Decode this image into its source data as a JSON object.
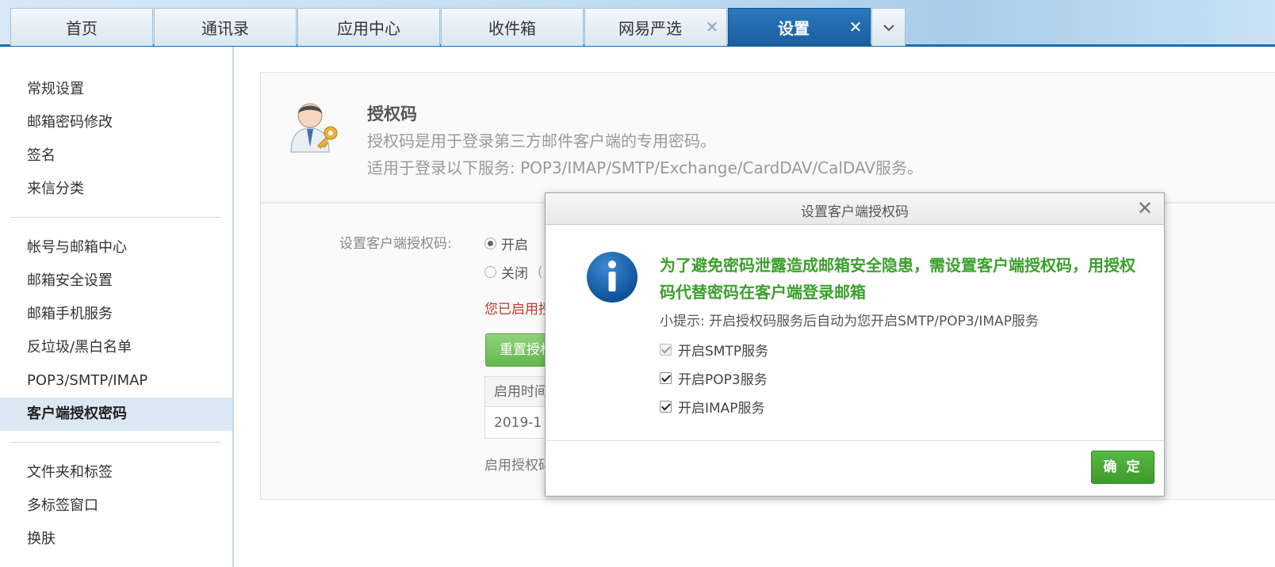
{
  "tabs": [
    {
      "label": "首页"
    },
    {
      "label": "通讯录"
    },
    {
      "label": "应用中心"
    },
    {
      "label": "收件箱"
    },
    {
      "label": "网易严选",
      "closable": true
    },
    {
      "label": "设置",
      "closable": true,
      "active": true
    }
  ],
  "tab_close_glyph": "✕",
  "sidebar": {
    "group1": [
      "常规设置",
      "邮箱密码修改",
      "签名",
      "来信分类"
    ],
    "group2": [
      "帐号与邮箱中心",
      "邮箱安全设置",
      "邮箱手机服务",
      "反垃圾/黑白名单",
      "POP3/SMTP/IMAP",
      "客户端授权密码"
    ],
    "group3": [
      "文件夹和标签",
      "多标签窗口",
      "换肤"
    ],
    "active": "客户端授权密码"
  },
  "content": {
    "title": "授权码",
    "desc1": "授权码是用于登录第三方邮件客户端的专用密码。",
    "desc2": "适用于登录以下服务: POP3/IMAP/SMTP/Exchange/CardDAV/CalDAV服务。",
    "setting_label": "设置客户端授权码:",
    "radio_on": "开启",
    "radio_off": "关闭",
    "radio_off_paren": "(",
    "enabled_text": "您已启用授",
    "reset_button": "重置授权",
    "table_header": "启用时间",
    "table_value": "2019-1",
    "footnote": "启用授权码"
  },
  "dialog": {
    "title": "设置客户端授权码",
    "close_glyph": "✕",
    "warning": "为了避免密码泄露造成邮箱安全隐患，需设置客户端授权码，用授权码代替密码在客户端登录邮箱",
    "tip": "小提示: 开启授权码服务后自动为您开启SMTP/POP3/IMAP服务",
    "options": [
      {
        "label": "开启SMTP服务",
        "checked": true,
        "disabled": true
      },
      {
        "label": "开启POP3服务",
        "checked": true,
        "disabled": false
      },
      {
        "label": "开启IMAP服务",
        "checked": true,
        "disabled": false
      }
    ],
    "ok_button": "确 定"
  },
  "colors": {
    "accent": "#1a5d9c",
    "success_green": "#3aa02b",
    "warning_red": "#c0392b"
  },
  "icons": [
    "user-key-icon",
    "info-icon",
    "close-icon",
    "chevron-down-icon"
  ]
}
